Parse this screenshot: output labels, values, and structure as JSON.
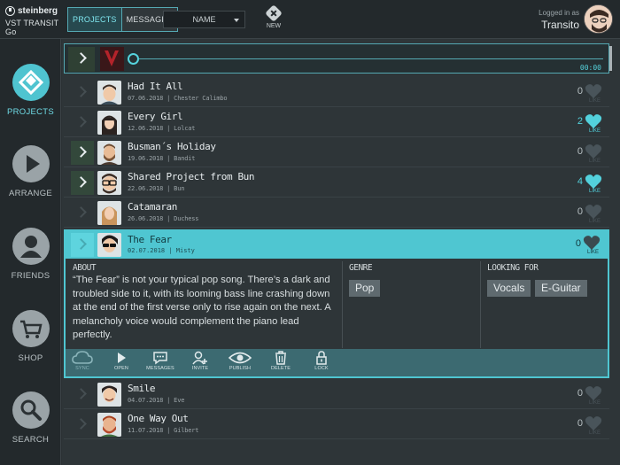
{
  "brand": {
    "name": "steinberg",
    "product": "VST TRANSIT Go"
  },
  "header": {
    "tabs": [
      {
        "label": "PROJECTS",
        "active": true
      },
      {
        "label": "MESSAGES",
        "active": false
      }
    ],
    "sort_select": "NAME",
    "new_label": "NEW",
    "login_caption": "Logged in as",
    "username": "Transito"
  },
  "sidebar": {
    "items": [
      {
        "label": "PROJECTS",
        "icon": "projects-icon",
        "active": true
      },
      {
        "label": "ARRANGE",
        "icon": "play-icon",
        "active": false
      },
      {
        "label": "FRIENDS",
        "icon": "person-icon",
        "active": false
      },
      {
        "label": "SHOP",
        "icon": "cart-icon",
        "active": false
      },
      {
        "label": "SEARCH",
        "icon": "magnifier-icon",
        "active": false
      }
    ]
  },
  "player": {
    "time": "00:00",
    "progress": 0
  },
  "projects": [
    {
      "title": "Had It All",
      "meta": "07.06.2018 | Chester Calimbo",
      "likes": "0",
      "liked": false,
      "highlight": false
    },
    {
      "title": "Every Girl",
      "meta": "12.06.2018 | Lolcat",
      "likes": "2",
      "liked": true,
      "highlight": false
    },
    {
      "title": "Busman´s Holiday",
      "meta": "19.06.2018 | Bandit",
      "likes": "0",
      "liked": false,
      "highlight": true
    },
    {
      "title": "Shared Project from Bun",
      "meta": "22.06.2018 | Bun",
      "likes": "4",
      "liked": true,
      "highlight": true
    },
    {
      "title": "Catamaran",
      "meta": "26.06.2018 | Duchess",
      "likes": "0",
      "liked": false,
      "highlight": false
    }
  ],
  "expanded": {
    "title": "The Fear",
    "meta": "02.07.2018 | Misty",
    "likes": "0",
    "like_label": "LIKE",
    "about_label": "ABOUT",
    "about_text": "“The Fear” is not your typical pop song.  There’s a dark and troubled side to it, with its looming bass line crashing down at the end of the first verse only to rise again on the next.  A melancholy voice would complement the piano lead perfectly.",
    "genre_label": "GENRE",
    "genres": [
      "Pop"
    ],
    "looking_for_label": "LOOKING FOR",
    "looking_for": [
      "Vocals",
      "E-Guitar"
    ],
    "tools": [
      "SYNC",
      "OPEN",
      "MESSAGES",
      "INVITE",
      "PUBLISH",
      "DELETE",
      "LOCK"
    ]
  },
  "projects_after": [
    {
      "title": "Smile",
      "meta": "04.07.2018 | Eve",
      "likes": "0",
      "liked": false
    },
    {
      "title": "One Way Out",
      "meta": "11.07.2018 | Gilbert",
      "likes": "0",
      "liked": false
    }
  ],
  "like_label": "LIKE",
  "colors": {
    "accent": "#4fc6d1",
    "background": "#2e3538",
    "sidebar": "#23292c"
  }
}
